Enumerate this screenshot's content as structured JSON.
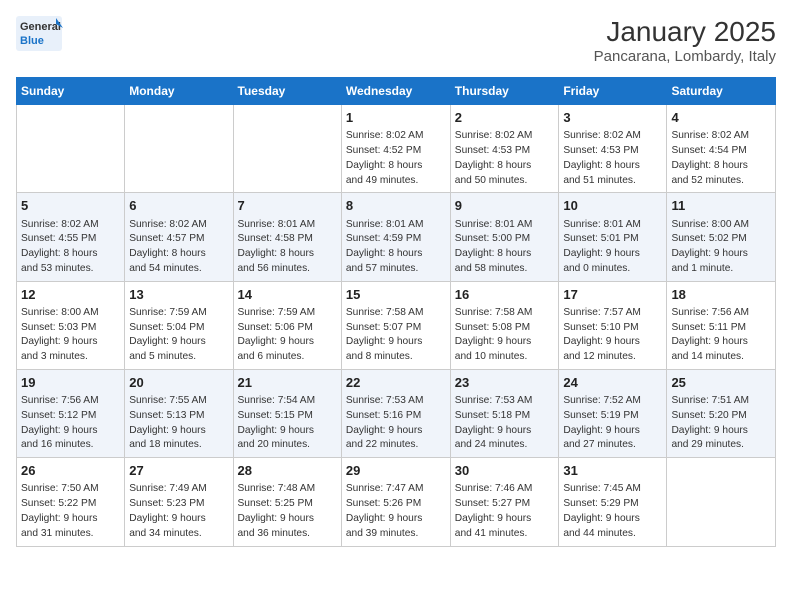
{
  "header": {
    "logo_line1": "General",
    "logo_line2": "Blue",
    "title": "January 2025",
    "subtitle": "Pancarana, Lombardy, Italy"
  },
  "days_of_week": [
    "Sunday",
    "Monday",
    "Tuesday",
    "Wednesday",
    "Thursday",
    "Friday",
    "Saturday"
  ],
  "weeks": [
    [
      {
        "day": "",
        "info": ""
      },
      {
        "day": "",
        "info": ""
      },
      {
        "day": "",
        "info": ""
      },
      {
        "day": "1",
        "info": "Sunrise: 8:02 AM\nSunset: 4:52 PM\nDaylight: 8 hours\nand 49 minutes."
      },
      {
        "day": "2",
        "info": "Sunrise: 8:02 AM\nSunset: 4:53 PM\nDaylight: 8 hours\nand 50 minutes."
      },
      {
        "day": "3",
        "info": "Sunrise: 8:02 AM\nSunset: 4:53 PM\nDaylight: 8 hours\nand 51 minutes."
      },
      {
        "day": "4",
        "info": "Sunrise: 8:02 AM\nSunset: 4:54 PM\nDaylight: 8 hours\nand 52 minutes."
      }
    ],
    [
      {
        "day": "5",
        "info": "Sunrise: 8:02 AM\nSunset: 4:55 PM\nDaylight: 8 hours\nand 53 minutes."
      },
      {
        "day": "6",
        "info": "Sunrise: 8:02 AM\nSunset: 4:57 PM\nDaylight: 8 hours\nand 54 minutes."
      },
      {
        "day": "7",
        "info": "Sunrise: 8:01 AM\nSunset: 4:58 PM\nDaylight: 8 hours\nand 56 minutes."
      },
      {
        "day": "8",
        "info": "Sunrise: 8:01 AM\nSunset: 4:59 PM\nDaylight: 8 hours\nand 57 minutes."
      },
      {
        "day": "9",
        "info": "Sunrise: 8:01 AM\nSunset: 5:00 PM\nDaylight: 8 hours\nand 58 minutes."
      },
      {
        "day": "10",
        "info": "Sunrise: 8:01 AM\nSunset: 5:01 PM\nDaylight: 9 hours\nand 0 minutes."
      },
      {
        "day": "11",
        "info": "Sunrise: 8:00 AM\nSunset: 5:02 PM\nDaylight: 9 hours\nand 1 minute."
      }
    ],
    [
      {
        "day": "12",
        "info": "Sunrise: 8:00 AM\nSunset: 5:03 PM\nDaylight: 9 hours\nand 3 minutes."
      },
      {
        "day": "13",
        "info": "Sunrise: 7:59 AM\nSunset: 5:04 PM\nDaylight: 9 hours\nand 5 minutes."
      },
      {
        "day": "14",
        "info": "Sunrise: 7:59 AM\nSunset: 5:06 PM\nDaylight: 9 hours\nand 6 minutes."
      },
      {
        "day": "15",
        "info": "Sunrise: 7:58 AM\nSunset: 5:07 PM\nDaylight: 9 hours\nand 8 minutes."
      },
      {
        "day": "16",
        "info": "Sunrise: 7:58 AM\nSunset: 5:08 PM\nDaylight: 9 hours\nand 10 minutes."
      },
      {
        "day": "17",
        "info": "Sunrise: 7:57 AM\nSunset: 5:10 PM\nDaylight: 9 hours\nand 12 minutes."
      },
      {
        "day": "18",
        "info": "Sunrise: 7:56 AM\nSunset: 5:11 PM\nDaylight: 9 hours\nand 14 minutes."
      }
    ],
    [
      {
        "day": "19",
        "info": "Sunrise: 7:56 AM\nSunset: 5:12 PM\nDaylight: 9 hours\nand 16 minutes."
      },
      {
        "day": "20",
        "info": "Sunrise: 7:55 AM\nSunset: 5:13 PM\nDaylight: 9 hours\nand 18 minutes."
      },
      {
        "day": "21",
        "info": "Sunrise: 7:54 AM\nSunset: 5:15 PM\nDaylight: 9 hours\nand 20 minutes."
      },
      {
        "day": "22",
        "info": "Sunrise: 7:53 AM\nSunset: 5:16 PM\nDaylight: 9 hours\nand 22 minutes."
      },
      {
        "day": "23",
        "info": "Sunrise: 7:53 AM\nSunset: 5:18 PM\nDaylight: 9 hours\nand 24 minutes."
      },
      {
        "day": "24",
        "info": "Sunrise: 7:52 AM\nSunset: 5:19 PM\nDaylight: 9 hours\nand 27 minutes."
      },
      {
        "day": "25",
        "info": "Sunrise: 7:51 AM\nSunset: 5:20 PM\nDaylight: 9 hours\nand 29 minutes."
      }
    ],
    [
      {
        "day": "26",
        "info": "Sunrise: 7:50 AM\nSunset: 5:22 PM\nDaylight: 9 hours\nand 31 minutes."
      },
      {
        "day": "27",
        "info": "Sunrise: 7:49 AM\nSunset: 5:23 PM\nDaylight: 9 hours\nand 34 minutes."
      },
      {
        "day": "28",
        "info": "Sunrise: 7:48 AM\nSunset: 5:25 PM\nDaylight: 9 hours\nand 36 minutes."
      },
      {
        "day": "29",
        "info": "Sunrise: 7:47 AM\nSunset: 5:26 PM\nDaylight: 9 hours\nand 39 minutes."
      },
      {
        "day": "30",
        "info": "Sunrise: 7:46 AM\nSunset: 5:27 PM\nDaylight: 9 hours\nand 41 minutes."
      },
      {
        "day": "31",
        "info": "Sunrise: 7:45 AM\nSunset: 5:29 PM\nDaylight: 9 hours\nand 44 minutes."
      },
      {
        "day": "",
        "info": ""
      }
    ]
  ]
}
